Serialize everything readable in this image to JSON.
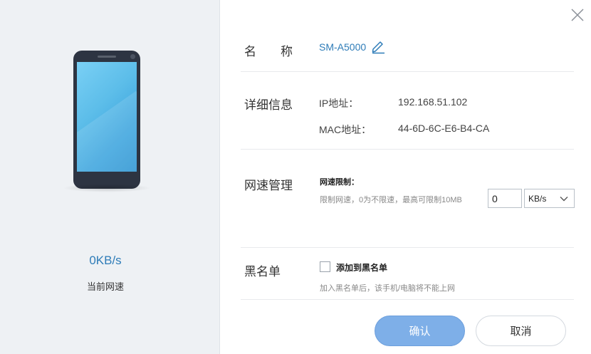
{
  "device": {
    "current_speed_value": "0KB/s",
    "current_speed_label": "当前网速"
  },
  "name_row": {
    "label": "名　　称",
    "device_name": "SM-A5000",
    "edit_icon": "pencil-icon"
  },
  "details_row": {
    "label": "详细信息",
    "ip_key": "IP地址：",
    "ip_value": "192.168.51.102",
    "mac_key": "MAC地址：",
    "mac_value": "44-6D-6C-E6-B4-CA"
  },
  "speed_row": {
    "label": "网速管理",
    "limit_title": "网速限制：",
    "limit_hint": "限制网速，0为不限速，最高可限制10MB",
    "limit_value": "0",
    "unit_selected": "KB/s"
  },
  "blacklist_row": {
    "label": "黑名单",
    "checkbox_label": "添加到黑名单",
    "checked": false,
    "hint": "加入黑名单后，该手机/电脑将不能上网"
  },
  "buttons": {
    "confirm_label": "确认",
    "cancel_label": "取消"
  },
  "colors": {
    "accent": "#2e7cb8",
    "confirm_bg": "#7eafe8",
    "left_panel_bg": "#eef1f4"
  }
}
